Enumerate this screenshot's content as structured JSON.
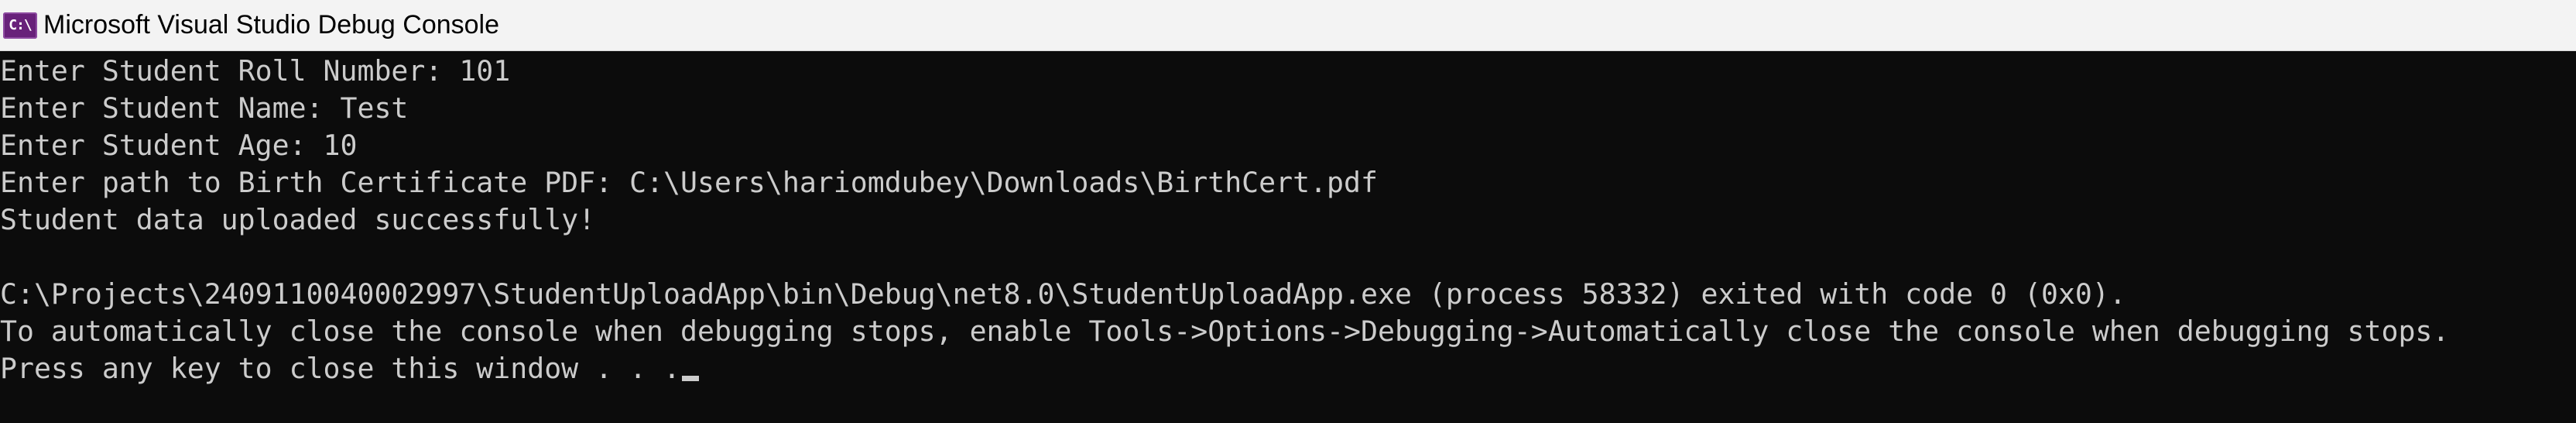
{
  "window": {
    "title": "Microsoft Visual Studio Debug Console",
    "icon": "visual-studio-console-icon",
    "icon_label": "C:\\",
    "accent_color": "#68217a",
    "background_color": "#0c0c0c",
    "text_color": "#cccccc"
  },
  "console": {
    "lines": [
      "Enter Student Roll Number: 101",
      "Enter Student Name: Test",
      "Enter Student Age: 10",
      "Enter path to Birth Certificate PDF: C:\\Users\\hariomdubey\\Downloads\\BirthCert.pdf",
      "Student data uploaded successfully!",
      "",
      "C:\\Projects\\2409110040002997\\StudentUploadApp\\bin\\Debug\\net8.0\\StudentUploadApp.exe (process 58332) exited with code 0 (0x0).",
      "To automatically close the console when debugging stops, enable Tools->Options->Debugging->Automatically close the console when debugging stops.",
      "Press any key to close this window . . ."
    ]
  }
}
